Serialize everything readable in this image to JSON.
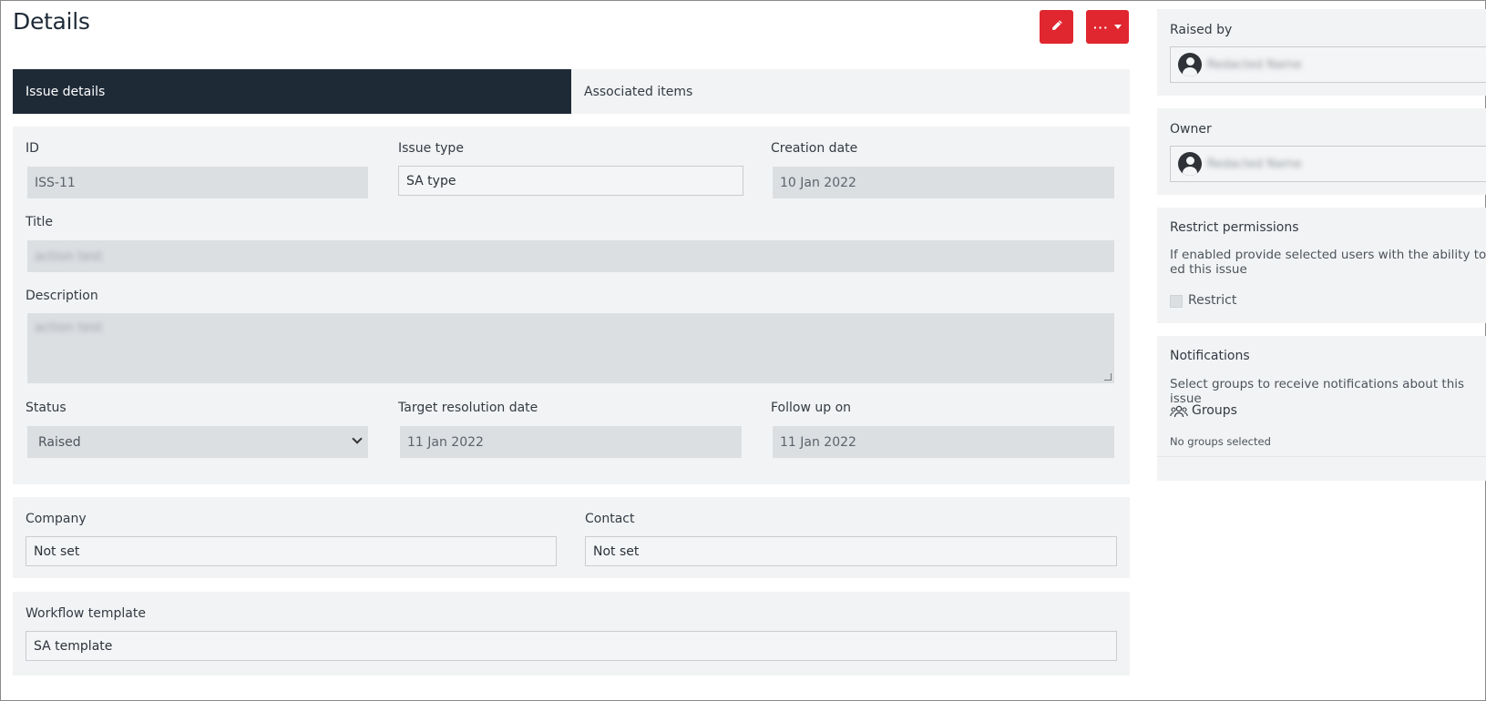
{
  "header": {
    "title": "Details",
    "more_label": "···"
  },
  "tabs": [
    {
      "label": "Issue details",
      "active": true
    },
    {
      "label": "Associated items",
      "active": false
    }
  ],
  "form": {
    "id_label": "ID",
    "id_value": "ISS-11",
    "issue_type_label": "Issue type",
    "issue_type_value": "SA type",
    "creation_date_label": "Creation date",
    "creation_date_value": "10 Jan 2022",
    "title_label": "Title",
    "title_value": "action test",
    "description_label": "Description",
    "description_value": "action test",
    "status_label": "Status",
    "status_value": "Raised",
    "target_date_label": "Target resolution date",
    "target_date_value": "11 Jan 2022",
    "follow_up_label": "Follow up on",
    "follow_up_value": "11 Jan 2022"
  },
  "company_section": {
    "company_label": "Company",
    "company_value": "Not set",
    "contact_label": "Contact",
    "contact_value": "Not set"
  },
  "workflow_section": {
    "label": "Workflow template",
    "value": "SA template"
  },
  "sidebar": {
    "raised_by_label": "Raised by",
    "raised_by_name": "Redacted Name",
    "owner_label": "Owner",
    "owner_name": "Redacted Name",
    "restrict_title": "Restrict permissions",
    "restrict_text": "If enabled provide selected users with the ability to ed this issue",
    "restrict_checkbox_label": "Restrict",
    "notifications_title": "Notifications",
    "notifications_text": "Select groups to receive notifications about this issue",
    "groups_label": "Groups",
    "no_groups_text": "No groups selected"
  },
  "colors": {
    "accent_red": "#e0262f",
    "active_tab": "#1f2a37",
    "panel_bg": "#f2f3f4",
    "readonly_bg": "#dcdfe2"
  },
  "icons": {
    "edit": "pencil-icon",
    "more": "ellipsis-icon",
    "avatar": "user-avatar-icon",
    "groups": "users-group-icon"
  }
}
